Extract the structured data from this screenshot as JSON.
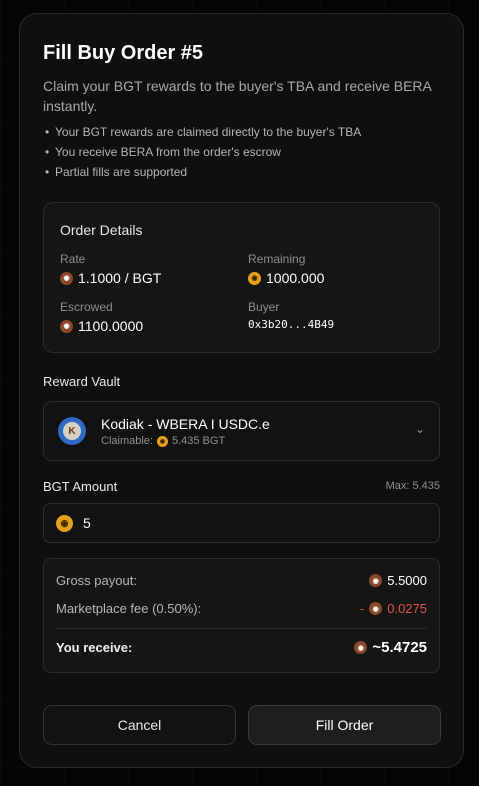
{
  "modal": {
    "title": "Fill Buy Order #5",
    "subtitle": "Claim your BGT rewards to the buyer's TBA and receive BERA instantly.",
    "bullets": [
      "Your BGT rewards are claimed directly to the buyer's TBA",
      "You receive BERA from the order's escrow",
      "Partial fills are supported"
    ]
  },
  "order_details": {
    "heading": "Order Details",
    "rate_label": "Rate",
    "rate_value": "1.1000 / BGT",
    "remaining_label": "Remaining",
    "remaining_value": "1000.000",
    "escrowed_label": "Escrowed",
    "escrowed_value": "1100.0000",
    "buyer_label": "Buyer",
    "buyer_value": "0x3b20...4B49"
  },
  "reward_vault": {
    "label": "Reward Vault",
    "name": "Kodiak - WBERA I USDC.e",
    "claimable_label": "Claimable:",
    "claimable_value": "5.435 BGT"
  },
  "bgt_amount": {
    "label": "BGT Amount",
    "max_text": "Max: 5.435",
    "value": "5"
  },
  "summary": {
    "gross_label": "Gross payout:",
    "gross_value": "5.5000",
    "fee_label": "Marketplace fee (0.50%):",
    "fee_value": "0.0275",
    "fee_prefix": "-",
    "receive_label": "You receive:",
    "receive_value": "~5.4725"
  },
  "buttons": {
    "cancel": "Cancel",
    "fill": "Fill Order"
  },
  "icons": {
    "bera_coin": "bera-token-icon",
    "bgt_coin": "bgt-token-icon",
    "vault_logo": "kodiak-vault-icon",
    "chevron": "chevron-down-icon"
  },
  "colors": {
    "fee": "#e0564e",
    "bera": "#8b4a2b",
    "bgt": "#e6a11a"
  }
}
